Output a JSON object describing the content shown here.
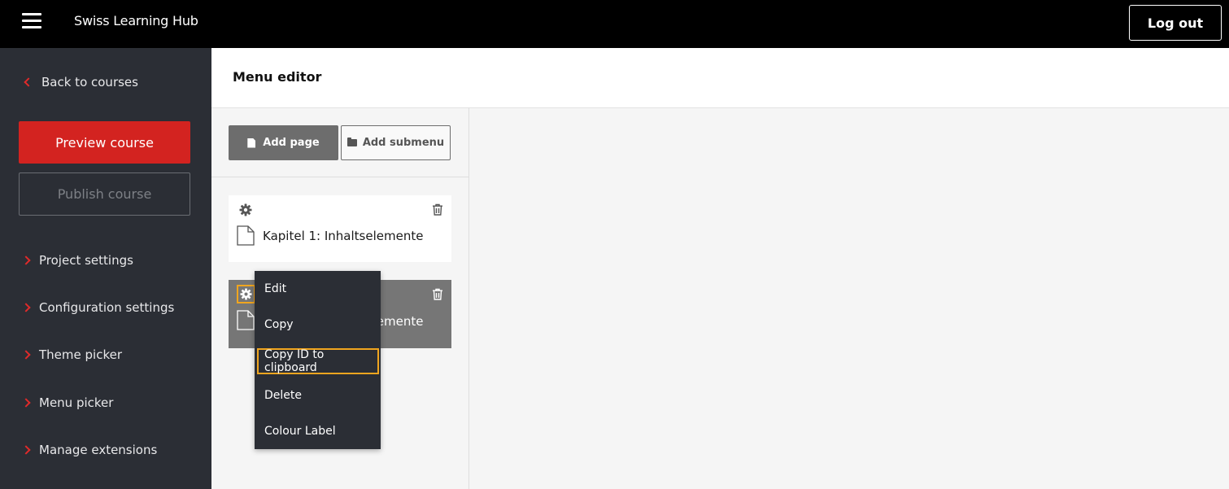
{
  "header": {
    "app_title": "Swiss Learning Hub",
    "logout_label": "Log out"
  },
  "sidebar": {
    "back_label": "Back to courses",
    "preview_label": "Preview course",
    "publish_label": "Publish course",
    "items": [
      {
        "label": "Project settings"
      },
      {
        "label": "Configuration settings"
      },
      {
        "label": "Theme picker"
      },
      {
        "label": "Menu picker"
      },
      {
        "label": "Manage extensions"
      }
    ]
  },
  "main": {
    "title": "Menu editor",
    "add_page_label": "Add page",
    "add_submenu_label": "Add submenu",
    "cards": [
      {
        "title": "Kapitel 1: Inhaltselemente"
      },
      {
        "title": "Kapitel 1: Inhaltselemente"
      }
    ]
  },
  "context_menu": {
    "items": [
      {
        "label": "Edit"
      },
      {
        "label": "Copy"
      },
      {
        "label": "Copy ID to clipboard"
      },
      {
        "label": "Delete"
      },
      {
        "label": "Colour Label"
      }
    ]
  },
  "colors": {
    "accent_red": "#d32320",
    "focus_outline": "#f0a51f",
    "sidebar_bg": "#2b2e35"
  }
}
